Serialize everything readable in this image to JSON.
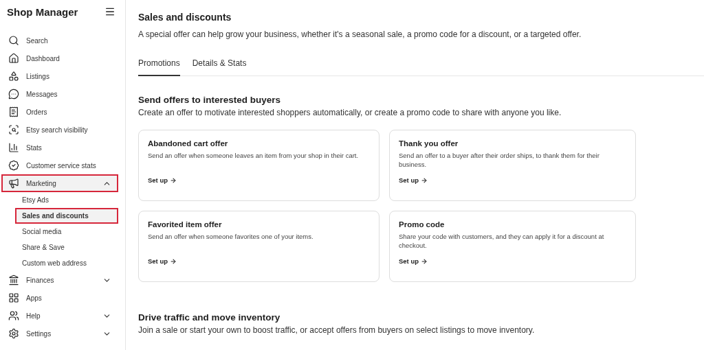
{
  "sidebar": {
    "title": "Shop Manager",
    "items": [
      {
        "label": "Search"
      },
      {
        "label": "Dashboard"
      },
      {
        "label": "Listings"
      },
      {
        "label": "Messages"
      },
      {
        "label": "Orders"
      },
      {
        "label": "Etsy search visibility"
      },
      {
        "label": "Stats"
      },
      {
        "label": "Customer service stats"
      },
      {
        "label": "Marketing",
        "expanded": true,
        "highlighted": true,
        "children": [
          {
            "label": "Etsy Ads",
            "selected": false,
            "highlighted": false
          },
          {
            "label": "Sales and discounts",
            "selected": true,
            "highlighted": true
          },
          {
            "label": "Social media",
            "selected": false,
            "highlighted": false
          },
          {
            "label": "Share & Save",
            "selected": false,
            "highlighted": false
          },
          {
            "label": "Custom web address",
            "selected": false,
            "highlighted": false
          }
        ]
      },
      {
        "label": "Finances",
        "expanded": false
      },
      {
        "label": "Apps"
      },
      {
        "label": "Help",
        "expanded": false
      },
      {
        "label": "Settings",
        "expanded": false
      }
    ]
  },
  "page": {
    "title": "Sales and discounts",
    "description": "A special offer can help grow your business, whether it's a seasonal sale, a promo code for a discount, or a targeted offer.",
    "tabs": [
      {
        "label": "Promotions",
        "selected": true
      },
      {
        "label": "Details & Stats",
        "selected": false
      }
    ],
    "sections": [
      {
        "heading": "Send offers to interested buyers",
        "description": "Create an offer to motivate interested shoppers automatically, or create a promo code to share with anyone you like.",
        "cards": [
          {
            "title": "Abandoned cart offer",
            "text": "Send an offer when someone leaves an item from your shop in their cart.",
            "action": "Set up"
          },
          {
            "title": "Thank you offer",
            "text": "Send an offer to a buyer after their order ships, to thank them for their business.",
            "action": "Set up"
          },
          {
            "title": "Favorited item offer",
            "text": "Send an offer when someone favorites one of your items.",
            "action": "Set up"
          },
          {
            "title": "Promo code",
            "text": "Share your code with customers, and they can apply it for a discount at checkout.",
            "action": "Set up"
          }
        ]
      },
      {
        "heading": "Drive traffic and move inventory",
        "description": "Join a sale or start your own to boost traffic, or accept offers from buyers on select listings to move inventory."
      }
    ]
  }
}
